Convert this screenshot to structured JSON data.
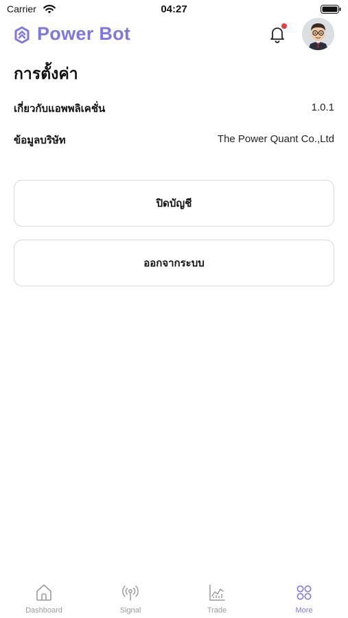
{
  "status_bar": {
    "carrier": "Carrier",
    "time": "04:27"
  },
  "header": {
    "brand": "Power Bot",
    "brand_color": "#7f76e6",
    "notification_dot_color": "#ee3b3b",
    "icons": [
      "logo-icon",
      "bell-icon",
      "avatar"
    ]
  },
  "settings": {
    "title": "การตั้งค่า",
    "rows": [
      {
        "label": "เกี่ยวกับแอพพลิเคชั่น",
        "value": "1.0.1"
      },
      {
        "label": "ข้อมูลบริษัท",
        "value": "The Power Quant Co.,Ltd"
      }
    ],
    "buttons": {
      "close_account": "ปิดบัญชี",
      "logout": "ออกจากระบบ"
    }
  },
  "tabbar": {
    "active": "More",
    "active_color": "#7f76e6",
    "items": [
      {
        "label": "Dashboard",
        "icon": "home-icon"
      },
      {
        "label": "Signal",
        "icon": "signal-icon"
      },
      {
        "label": "Trade",
        "icon": "chart-icon"
      },
      {
        "label": "More",
        "icon": "grid-icon"
      }
    ]
  }
}
